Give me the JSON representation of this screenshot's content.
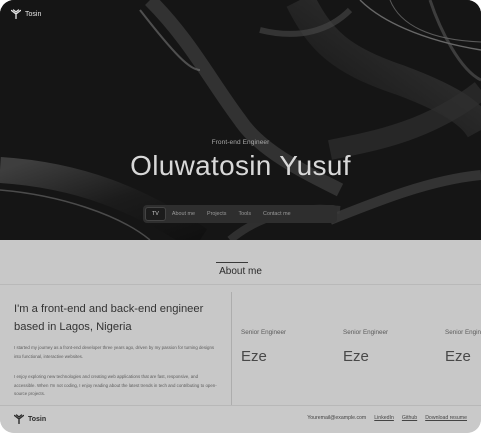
{
  "brand": {
    "name": "Tosin",
    "icon": "y-logo-icon"
  },
  "hero": {
    "subtitle": "Front-end Engineer",
    "title": "Oluwatosin Yusuf"
  },
  "nav": {
    "items": [
      {
        "label": "TV",
        "active": true
      },
      {
        "label": "About me"
      },
      {
        "label": "Projects"
      },
      {
        "label": "Tools"
      },
      {
        "label": "Contact me"
      }
    ]
  },
  "about": {
    "heading": "About me",
    "headline": "I'm a front-end and back-end engineer based in Lagos, Nigeria",
    "paragraphs": [
      "I started my journey as a front-end developer three years ago, driven by my passion for turning designs into functional, interactive websites.",
      "I enjoy exploring new technologies and creating web applications that are fast, responsive, and accessible. When I'm not coding, I enjoy reading about the latest trends in tech and contributing to open-source projects."
    ],
    "experience": [
      {
        "role": "Senior Engineer",
        "company": "Eze"
      },
      {
        "role": "Senior Engineer",
        "company": "Eze"
      },
      {
        "role": "Senior Engineer",
        "company": "Eze"
      }
    ]
  },
  "footer": {
    "email": "Youremail@example.com",
    "links": [
      "LinkedIn",
      "Github",
      "Download resume"
    ]
  },
  "colors": {
    "hero_bg": "#141414",
    "page_bg": "#c8c8c8",
    "nav_bg": "#2e2e2e"
  }
}
